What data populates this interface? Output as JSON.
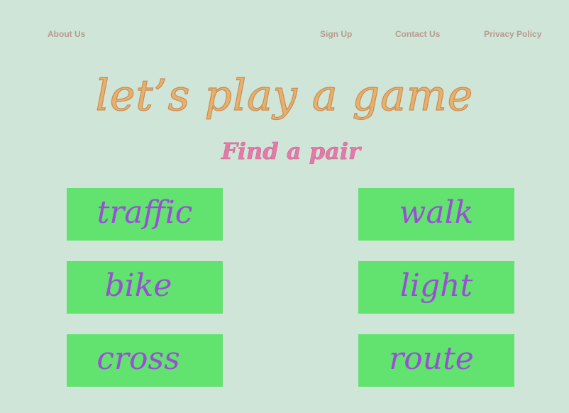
{
  "nav": {
    "about": "About Us",
    "signup": "Sign Up",
    "contact": "Contact Us",
    "privacy": "Privacy Policy"
  },
  "game": {
    "title": "let’s play a game",
    "subtitle": "Find a pair",
    "cards": [
      "traffic",
      "walk",
      "bike",
      "light",
      "cross",
      "route"
    ]
  },
  "colors": {
    "background": "#cfe5d8",
    "nav_text": "#b89a8e",
    "title": "#e8b16a",
    "subtitle": "#e57aa8",
    "card_fill": "#62e36f",
    "card_text": "#9a4ed6"
  }
}
